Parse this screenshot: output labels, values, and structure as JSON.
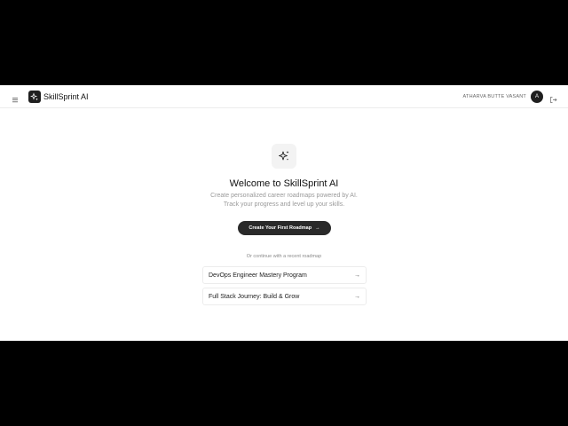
{
  "header": {
    "brand": "SkillSprint AI",
    "user_name": "ATHARVA BUTTE VASANT",
    "avatar_initial": "A"
  },
  "main": {
    "title": "Welcome to SkillSprint AI",
    "subtitle_line1": "Create personalized career roadmaps powered by AI.",
    "subtitle_line2": "Track your progress and level up your skills.",
    "cta_label": "Create Your First Roadmap",
    "cta_arrow": "→",
    "or_text": "Or continue with a recent roadmap",
    "recent_roadmaps": [
      {
        "label": "DevOps Engineer Mastery Program",
        "arrow": "→"
      },
      {
        "label": "Full Stack Journey: Build & Grow",
        "arrow": "→"
      }
    ]
  },
  "icons": {
    "menu": "hamburger-icon",
    "logo": "sparkles-icon",
    "hero": "sparkles-icon",
    "logout": "logout-icon"
  },
  "colors": {
    "primary": "#1f1f1f",
    "background": "#ffffff",
    "muted_text": "#9a9a9a",
    "border": "#ececec"
  }
}
